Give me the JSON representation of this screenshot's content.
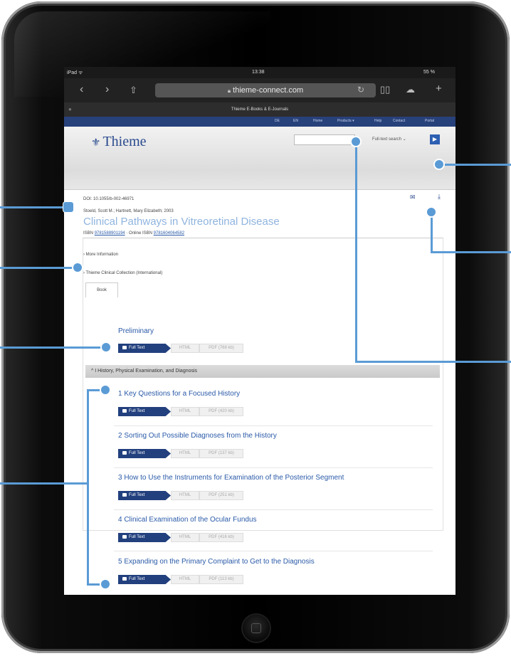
{
  "status": {
    "carrier": "iPad ᯤ",
    "time": "13:38",
    "battery": "55 %"
  },
  "browser": {
    "url": "thieme-connect.com",
    "page_title": "Thieme E-Books & E-Journals",
    "icons": [
      "back-icon",
      "forward-icon",
      "share-icon",
      "reload-icon",
      "bookmarks-icon",
      "cloud-icon",
      "new-tab-icon"
    ]
  },
  "site": {
    "nav_items": [
      "DE",
      "EN",
      "Home",
      "Products ▾",
      "Help",
      "Contact",
      "Portal"
    ],
    "logo_text": "Thieme",
    "search_placeholder": "",
    "search_mode": "Full-text search",
    "search_go": "▶"
  },
  "article": {
    "doi": "DOI: 10.1055/b-002-46971",
    "authors": "Stoeld, Scott M.; Hartnett, Mary Elizabeth; 2003",
    "title": "Clinical Pathways in Vitreoretinal Disease",
    "isbn_label": "ISBN",
    "isbn": "9781588901194",
    "online_isbn_label": " · Online ISBN",
    "online_isbn": "9781604064582",
    "more_info": "› More Information",
    "collection": "› Thieme Clinical Collection (International)"
  },
  "content": {
    "tab_label": "Book",
    "full_text_label": "Full Text",
    "html_label": "HTML",
    "preliminary": {
      "title": "Preliminary",
      "pdf": "PDF (768 kb)"
    },
    "section_title": "^ I History, Physical Examination, and Diagnosis",
    "chapters": [
      {
        "title": "1 Key Questions for a Focused History",
        "pdf": "PDF (420 kb)"
      },
      {
        "title": "2 Sorting Out Possible Diagnoses from the History",
        "pdf": "PDF (137 kb)"
      },
      {
        "title": "3 How to Use the Instruments for Examination of the Posterior Segment",
        "pdf": "PDF (251 kb)"
      },
      {
        "title": "4 Clinical Examination of the Ocular Fundus",
        "pdf": "PDF (416 kb)"
      },
      {
        "title": "5 Expanding on the Primary Complaint to Get to the Diagnosis",
        "pdf": "PDF (113 kb)"
      }
    ]
  },
  "colors": {
    "nav_bar": "#27417a",
    "link": "#2a5aa8",
    "title": "#8fb4df",
    "callout": "#5a9bd5",
    "button": "#22407e"
  }
}
